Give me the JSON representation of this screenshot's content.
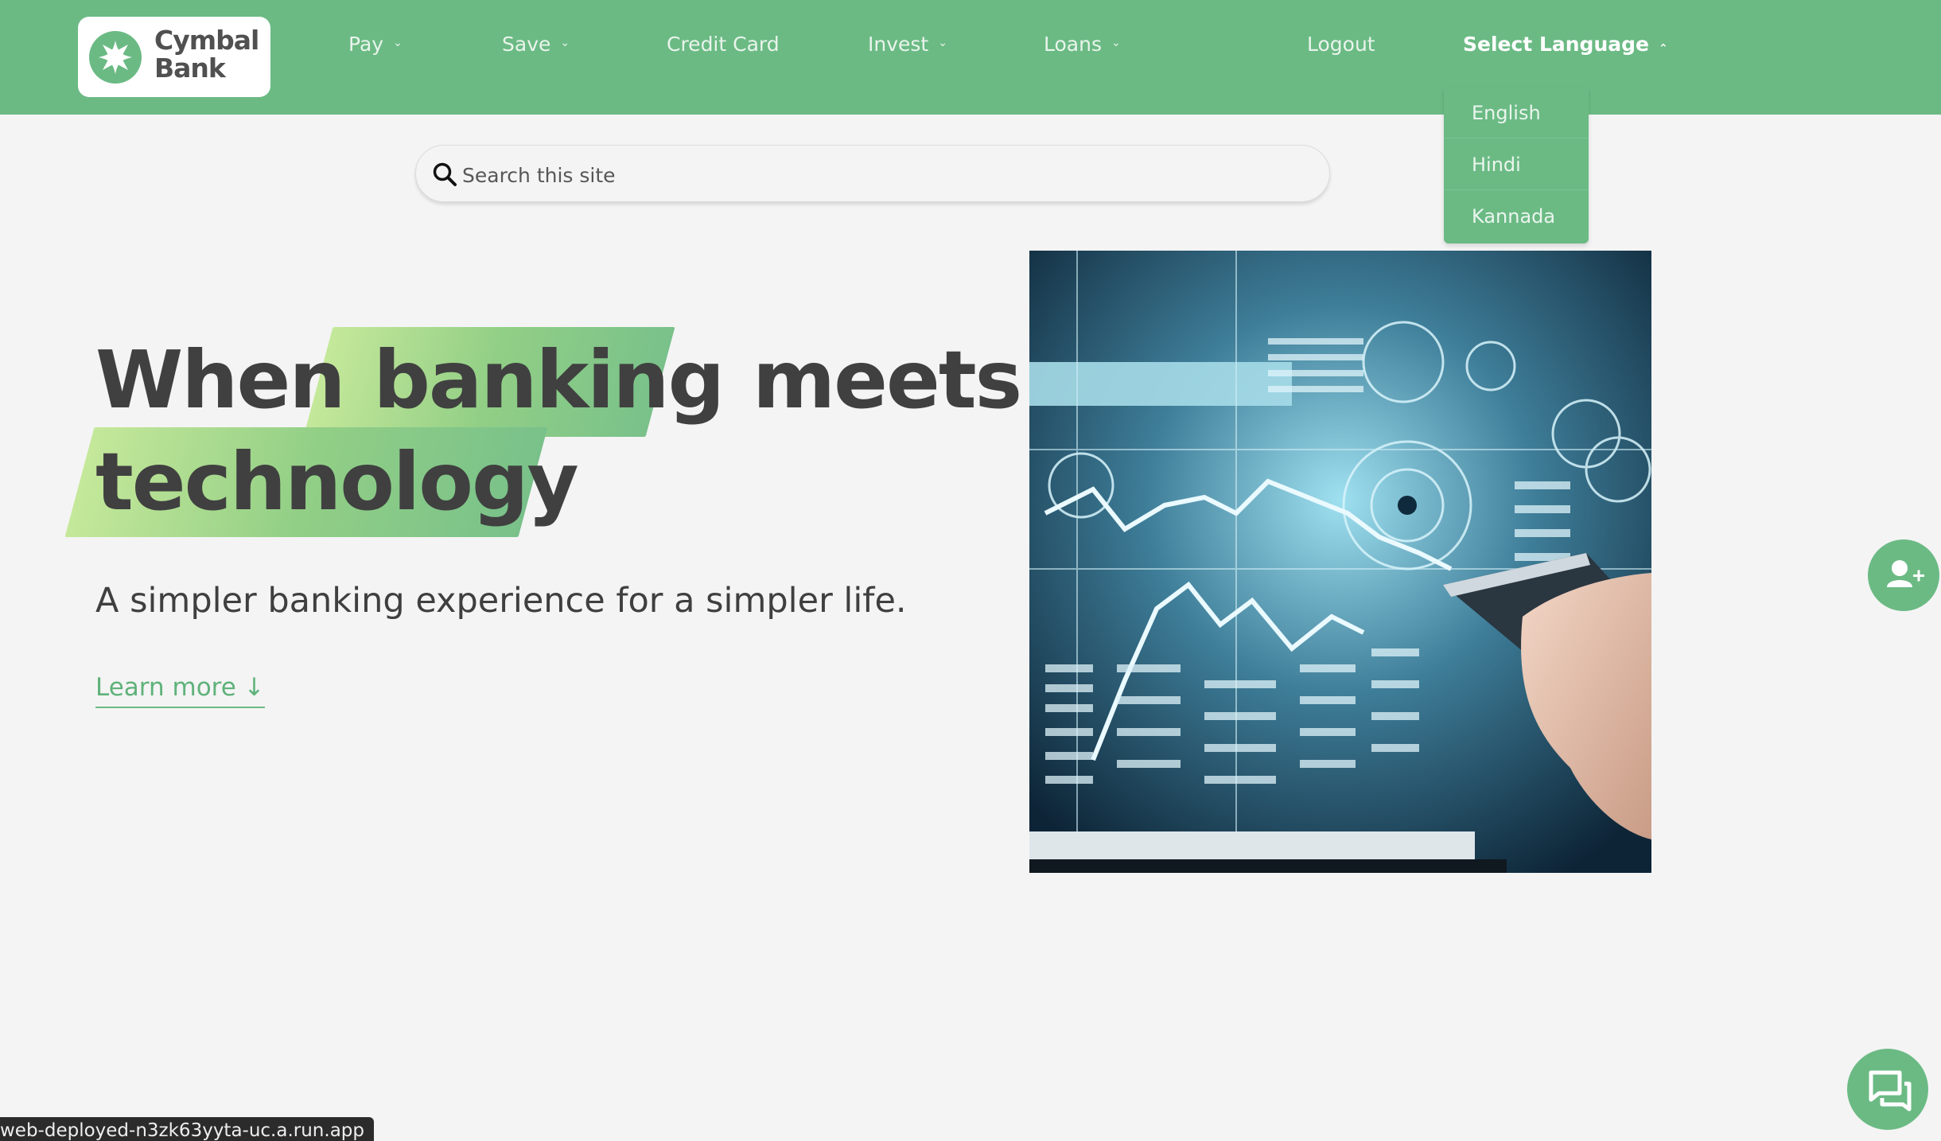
{
  "brand": {
    "name_line1": "Cymbal",
    "name_line2": "Bank",
    "accent_color": "#6bba84"
  },
  "nav": {
    "items": [
      {
        "label": "Pay",
        "has_dropdown": true
      },
      {
        "label": "Save",
        "has_dropdown": true
      },
      {
        "label": "Credit Card",
        "has_dropdown": false
      },
      {
        "label": "Invest",
        "has_dropdown": true
      },
      {
        "label": "Loans",
        "has_dropdown": true
      }
    ],
    "logout": "Logout",
    "language_label": "Select Language",
    "language_options": [
      "English",
      "Hindi",
      "Kannada"
    ]
  },
  "search": {
    "placeholder": "Search this site",
    "icon": "search-icon"
  },
  "hero": {
    "word1": "When",
    "word2": "banking",
    "word3": "meets",
    "word4": "technology",
    "subtitle": "A simpler banking experience for a simpler life.",
    "learn_more": "Learn more ↓"
  },
  "floating": {
    "add_user_icon": "add-user-icon",
    "chat_icon": "chat-icon"
  },
  "status_bar": {
    "url": "web-deployed-n3zk63yyta-uc.a.run.app"
  }
}
